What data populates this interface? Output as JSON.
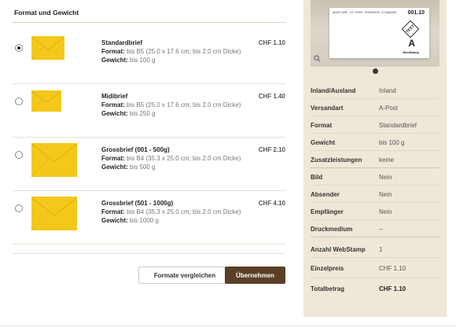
{
  "section_title": "Format und Gewicht",
  "options": [
    {
      "name": "Standardbrief",
      "price": "CHF 1.10",
      "format_label": "Format:",
      "format_value": "bis B5 (25.0 x 17.6 cm; bis 2.0 cm Dicke)",
      "weight_label": "Gewicht:",
      "weight_value": "bis 100 g",
      "selected": true
    },
    {
      "name": "Midibrief",
      "price": "CHF 1.40",
      "format_label": "Format:",
      "format_value": "bis B5 (25.0 x 17.6 cm; bis 2.0 cm Dicke)",
      "weight_label": "Gewicht:",
      "weight_value": "bis 250 g",
      "selected": false
    },
    {
      "name": "Grossbrief (001 - 500g)",
      "price": "CHF 2.10",
      "format_label": "Format:",
      "format_value": "bis B4 (35.3 x 25.0 cm; bis 2.0 cm Dicke)",
      "weight_label": "Gewicht:",
      "weight_value": "bis 500 g",
      "selected": false
    },
    {
      "name": "Grossbrief (501 - 1000g)",
      "price": "CHF 4.10",
      "format_label": "Format:",
      "format_value": "bis B4 (35.3 x 25.0 cm; bis 2.0 cm Dicke)",
      "weight_label": "Gewicht:",
      "weight_value": "bis 1000 g",
      "selected": false
    }
  ],
  "buttons": {
    "compare": "Formate vergleichen",
    "next": "Übernehmen"
  },
  "preview": {
    "amount": "001.10",
    "test_label": "TEST",
    "class_letter": "A",
    "brand_label": "WebStamp",
    "stamp_line": "WEBSTAMP  CH 0000  00000000",
    "standard_label": "STANDARD"
  },
  "summary": [
    {
      "key": "Inland/Ausland",
      "value": "Inland"
    },
    {
      "key": "Versandart",
      "value": "A-Post"
    },
    {
      "key": "Format",
      "value": "Standardbrief"
    },
    {
      "key": "Gewicht",
      "value": "bis 100 g"
    },
    {
      "key": "Zusatzleistungen",
      "value": "keine"
    },
    {
      "key": "Bild",
      "value": "Nein"
    },
    {
      "key": "Absender",
      "value": "Nein"
    },
    {
      "key": "Empfänger",
      "value": "Nein"
    },
    {
      "key": "Druckmedium",
      "value": "--"
    },
    {
      "key": "Anzahl WebStamp",
      "value": "1"
    },
    {
      "key": "Einzelpreis",
      "value": "CHF 1.10"
    },
    {
      "key": "Totalbetrag",
      "value": "CHF 1.10"
    }
  ],
  "colors": {
    "accent": "#5a4026",
    "panel": "#efe8d8",
    "envelope": "#f4c81a"
  }
}
